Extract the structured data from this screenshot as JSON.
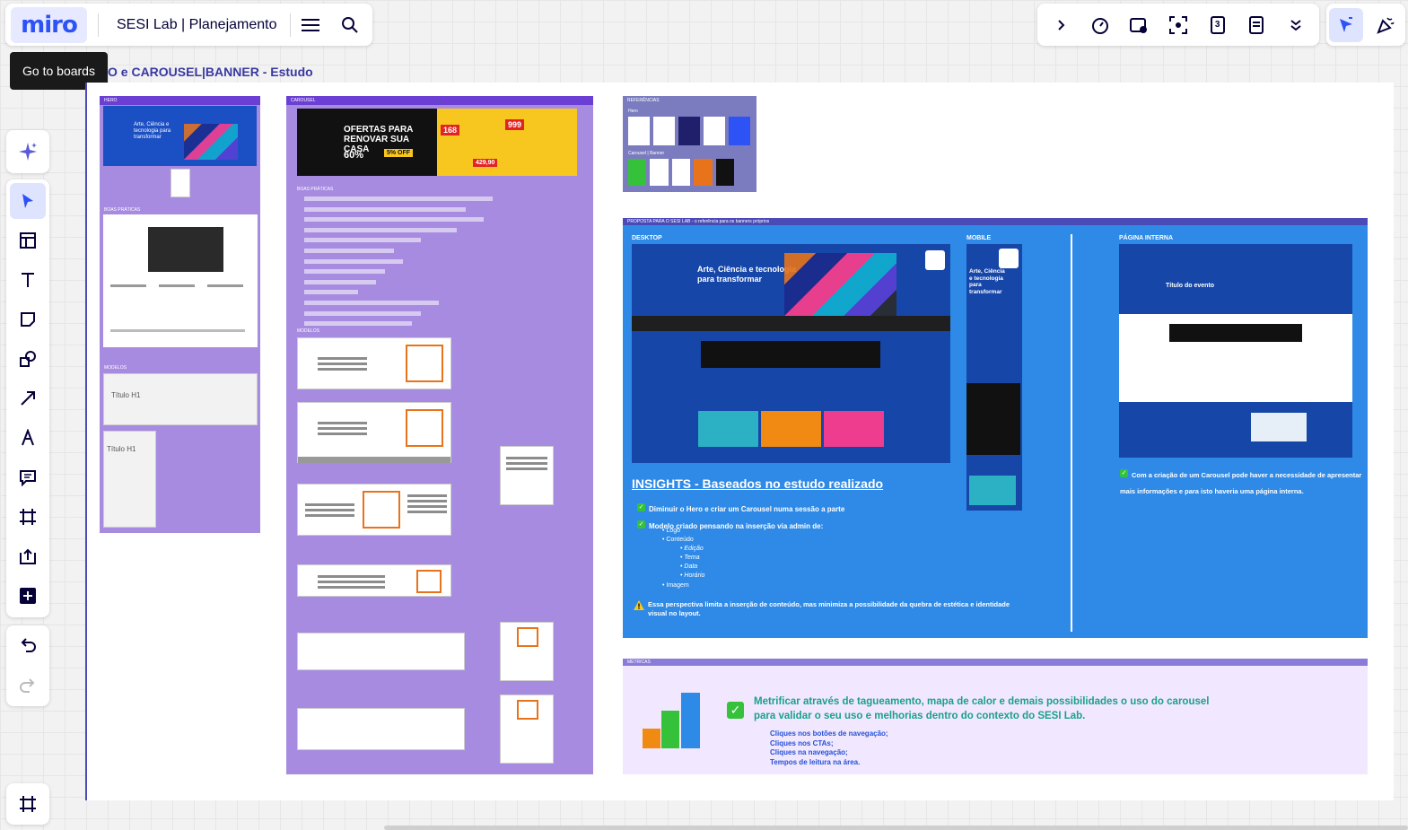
{
  "app": {
    "logo_text": "miro",
    "board_title": "SESI Lab | Planejamento",
    "tooltip": "Go to boards",
    "accent": "#2d52f5"
  },
  "toolbar_top_left": {
    "icons": [
      "hamburger-menu-icon",
      "search-icon"
    ]
  },
  "toolbar_top_right": {
    "icons": [
      "chevron-right-icon",
      "timer-icon",
      "video-icon",
      "focus-icon",
      "counter-icon",
      "notes-icon",
      "chevron-down-icon"
    ],
    "counter_label": "3",
    "tools2": [
      "reaction-cursor-icon",
      "celebrate-icon"
    ]
  },
  "left_toolbar": {
    "ai_icon": "sparkle-icon",
    "tools": [
      "select-icon",
      "templates-icon",
      "text-icon",
      "sticky-note-icon",
      "shapes-icon",
      "connector-icon",
      "pen-icon",
      "comment-icon",
      "frame-icon",
      "upload-icon",
      "more-tools-icon"
    ],
    "undo": "undo-icon",
    "redo": "redo-icon",
    "frames": "frames-list-icon"
  },
  "canvas": {
    "frame_label": "O e CAROUSEL|BANNER - Estudo",
    "panel_hero_label": "HERO",
    "panel_hero_section1": "BOAS PRÁTICAS",
    "panel_hero_section2": "MODELOS",
    "hero_card_title": "Título H1",
    "hero_card_title2": "Título H1",
    "panel_carousel_label": "CAROUSEL",
    "carousel_banner_headline": "OFERTAS PARA RENOVAR SUA CASA",
    "carousel_banner_price1": "168",
    "carousel_banner_price2": "999",
    "carousel_banner_discount": "60%",
    "carousel_banner_discount2": "5% OFF",
    "carousel_banner_price3": "429,90",
    "carousel_section1": "BOAS PRÁTICAS",
    "carousel_section2": "MODELOS",
    "refs_label": "REFERÊNCIAS",
    "refs_hero": "Hero",
    "refs_carousel": "Carousel | Banner",
    "blue_head": "PROPOSTA PARA O SESI LAB - o referência para os banners próprios",
    "desktop_label": "DESKTOP",
    "mobile_label": "MOBILE",
    "internal_label": "PÁGINA INTERNA",
    "hero_headline": "Arte, Ciência e tecnologia para transformar",
    "mobile_headline": "Arte, Ciência e tecnologia para transformar",
    "internal_title": "Título do evento",
    "insights_title": "INSIGHTS - Baseados no estudo realizado",
    "insight1": "Diminuir o Hero e criar um Carousel numa sessão a parte",
    "insight2": "Modelo criado pensando na inserção via admin de:",
    "insight2_items": [
      "Logo",
      "Conteúdo",
      "Edição",
      "Tema",
      "Data",
      "Horário",
      "Imagem"
    ],
    "warning": "Essa perspectiva limita a inserção de conteúdo, mas minimiza a possibilidade da quebra de estética e identidade visual no layout.",
    "internal_note": "Com a criação de um Carousel pode haver a necessidade de apresentar mais informações e para isto haveria uma página interna.",
    "metrics_head": "MÉTRICAS",
    "metrics_text": "Metrificar através de tagueamento, mapa de calor e demais possibilidades o uso do carousel para validar o seu uso e melhorias dentro do contexto do SESI Lab.",
    "metrics_list": [
      "Cliques nos botões de navegação;",
      "Cliques nos CTAs;",
      "Cliques na navegação;",
      "Tempos de leitura na área."
    ]
  }
}
